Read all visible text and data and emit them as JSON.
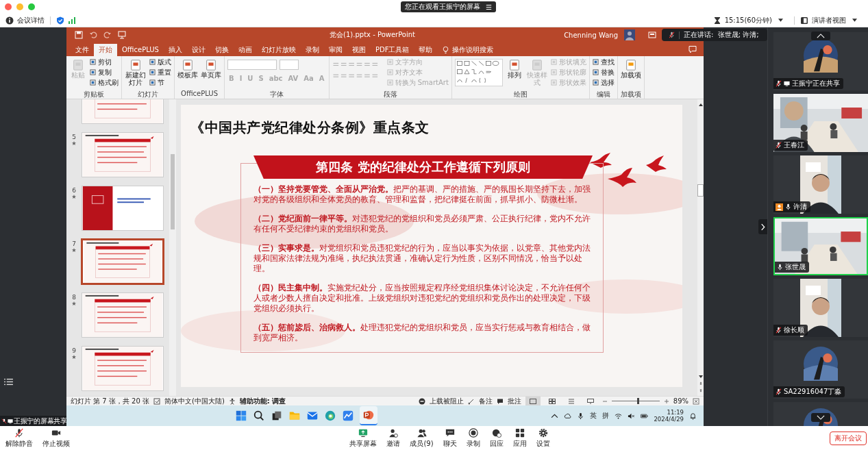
{
  "top_bar": {
    "banner": "您正在观看王振宁的屏幕",
    "banner_icon": "☰"
  },
  "meeting_bar": {
    "details": "会议详情",
    "timer": "15:15(60分钟)",
    "view": "演讲者视图"
  },
  "powerpoint": {
    "title": "党会(1).pptx  -  PowerPoint",
    "user": "Chenning Wang",
    "tabs": [
      {
        "label": "文件",
        "selected": false
      },
      {
        "label": "开始",
        "selected": true
      },
      {
        "label": "OfficePLUS",
        "selected": false
      },
      {
        "label": "插入",
        "selected": false
      },
      {
        "label": "设计",
        "selected": false
      },
      {
        "label": "切换",
        "selected": false
      },
      {
        "label": "动画",
        "selected": false
      },
      {
        "label": "幻灯片放映",
        "selected": false
      },
      {
        "label": "录制",
        "selected": false
      },
      {
        "label": "审阅",
        "selected": false
      },
      {
        "label": "视图",
        "selected": false
      },
      {
        "label": "PDF工具箱",
        "selected": false
      },
      {
        "label": "帮助",
        "selected": false
      }
    ],
    "search": "操作说明搜索",
    "ribbon_groups": [
      {
        "name": "剪贴板",
        "kind": "plain",
        "items": [
          {
            "label": "粘贴",
            "kind": "large",
            "disabled": true
          },
          {
            "label": "剪切",
            "kind": "small",
            "disabled": false
          },
          {
            "label": "复制",
            "kind": "small",
            "disabled": false
          },
          {
            "label": "格式刷",
            "kind": "small",
            "disabled": false
          }
        ]
      },
      {
        "name": "幻灯片",
        "kind": "plain",
        "items": [
          {
            "label": "新建幻灯片",
            "kind": "large",
            "disabled": false
          },
          {
            "label": "版式",
            "kind": "small",
            "disabled": false
          },
          {
            "label": "重置",
            "kind": "small",
            "disabled": false
          },
          {
            "label": "节",
            "kind": "small",
            "disabled": false
          }
        ]
      },
      {
        "name": "OfficePLUS",
        "kind": "plain",
        "items": [
          {
            "label": "模板库",
            "kind": "large",
            "disabled": false
          },
          {
            "label": "单页库",
            "kind": "large",
            "disabled": false
          }
        ]
      },
      {
        "name": "字体",
        "kind": "font",
        "items": [
          {
            "label": "B",
            "kind": "glyph",
            "disabled": true
          },
          {
            "label": "I",
            "kind": "glyph",
            "disabled": true
          },
          {
            "label": "U",
            "kind": "glyph",
            "disabled": true
          },
          {
            "label": "S",
            "kind": "glyph",
            "disabled": true
          },
          {
            "label": "abc",
            "kind": "glyph",
            "disabled": true
          },
          {
            "label": "AV",
            "kind": "glyph",
            "disabled": true
          },
          {
            "label": "Aa",
            "kind": "glyph",
            "disabled": true
          },
          {
            "label": "A",
            "kind": "glyph",
            "disabled": true
          }
        ]
      },
      {
        "name": "段落",
        "kind": "paragraph",
        "items": [
          {
            "label": "文字方向",
            "kind": "small",
            "disabled": true
          },
          {
            "label": "对齐文本",
            "kind": "small",
            "disabled": true
          },
          {
            "label": "转换为 SmartArt",
            "kind": "small",
            "disabled": true
          }
        ]
      },
      {
        "name": "绘图",
        "kind": "drawing",
        "items": [
          {
            "label": "排列",
            "kind": "large",
            "disabled": false
          },
          {
            "label": "快速样式",
            "kind": "large",
            "disabled": true
          },
          {
            "label": "形状填充",
            "kind": "small",
            "disabled": true
          },
          {
            "label": "形状轮廓",
            "kind": "small",
            "disabled": true
          },
          {
            "label": "形状效果",
            "kind": "small",
            "disabled": true
          }
        ]
      },
      {
        "name": "编辑",
        "kind": "plain",
        "items": [
          {
            "label": "查找",
            "kind": "small",
            "disabled": false
          },
          {
            "label": "替换",
            "kind": "small",
            "disabled": false
          },
          {
            "label": "选择",
            "kind": "small",
            "disabled": false
          }
        ]
      },
      {
        "name": "加载项",
        "kind": "plain",
        "items": [
          {
            "label": "加载项",
            "kind": "large",
            "disabled": false
          }
        ]
      }
    ],
    "thumbnails": [
      {
        "kind": "content",
        "selected": false
      },
      {
        "number": "5",
        "kind": "content",
        "selected": false
      },
      {
        "number": "6",
        "kind": "cover",
        "selected": false
      },
      {
        "number": "7",
        "kind": "content",
        "selected": true
      },
      {
        "number": "8",
        "kind": "content",
        "selected": false
      },
      {
        "number": "9",
        "kind": "content",
        "selected": false
      }
    ],
    "slide": {
      "title": "《中国共产党纪律处分条例》重点条文",
      "heading": "第四条 党的纪律处分工作遵循下列原则",
      "paragraphs": [
        "**（一）坚持党要管党、全面从严治党。**把严的基调、严的措施、严的氛围长期坚持下去，加强对党的各级组织和全体党员的教育、管理和监督，把纪律挺在前面，抓早抓小、防微杜渐。",
        "**（二）党纪面前一律平等。**对违犯党纪的党组织和党员必须严肃、公正执行纪律，党内不允许有任何不受纪律约束的党组织和党员。",
        "**（三）实事求是。**对党组织和党员违犯党纪的行为，应当以事实为依据，以党章、其他党内法规和国家法律法规为准绳，执纪执法贯通，准确认定行为性质，区别不同情况，恰当予以处理。",
        "**（四）民主集中制。**实施党纪处分，应当按照规定程序经党组织集体讨论决定，不允许任何个人或者少数人擅自决定和批准。上级党组织对违犯党纪的党组织和党员作出的处理决定，下级党组织必须执行。",
        "**（五）惩前毖后、治病救人。**处理违犯党纪的党组织和党员，应当实行惩戒与教育相结合，做到宽严相济。"
      ]
    },
    "status_bar": {
      "slide_info": "幻灯片 第 7 张，共 20 张",
      "language": "简体中文(中国大陆)",
      "accessibility": "辅助功能: 调查",
      "upload": "上载被阻止",
      "notes": "备注",
      "comments": "批注",
      "zoom": "89%",
      "zoom_slider": {
        "level": 0.55
      }
    },
    "taskbar": {
      "ime": [
        "英",
        "拼"
      ],
      "time": "11:19",
      "date": "2024/4/29"
    }
  },
  "speaking": "正在讲话:  张世晟; 许清;",
  "share_label": "王振宁的屏幕共享",
  "participants": [
    {
      "name": "王振宁正在共享",
      "kind": "avatar",
      "muted": true,
      "sharing": true,
      "host": false,
      "active": false
    },
    {
      "name": "王春江",
      "kind": "video",
      "muted": true,
      "sharing": false,
      "host": false,
      "active": false
    },
    {
      "name": "许清",
      "kind": "portrait",
      "muted": false,
      "sharing": false,
      "host": true,
      "active": false
    },
    {
      "name": "张世晟",
      "kind": "video",
      "muted": false,
      "sharing": false,
      "host": false,
      "active": true
    },
    {
      "name": "徐长顺",
      "kind": "portrait",
      "muted": true,
      "sharing": false,
      "host": false,
      "active": false
    },
    {
      "name": "SA22916047丁淼",
      "kind": "avatar",
      "muted": true,
      "sharing": false,
      "host": false,
      "active": false
    },
    {
      "kind": "avatar",
      "active": false
    }
  ],
  "toolbar": {
    "left": [
      {
        "label": "解除静音",
        "kind": "mic"
      },
      {
        "label": "停止视频",
        "kind": "video"
      }
    ],
    "center": [
      {
        "label": "共享屏幕",
        "kind": "share"
      },
      {
        "label": "邀请",
        "kind": "invite"
      },
      {
        "label": "成员(9)",
        "kind": "members"
      },
      {
        "label": "聊天",
        "kind": "chat"
      },
      {
        "label": "录制",
        "kind": "record"
      },
      {
        "label": "回应",
        "kind": "react"
      },
      {
        "label": "应用",
        "kind": "apps"
      },
      {
        "label": "设置",
        "kind": "settings"
      }
    ],
    "leave": "离开会议"
  }
}
